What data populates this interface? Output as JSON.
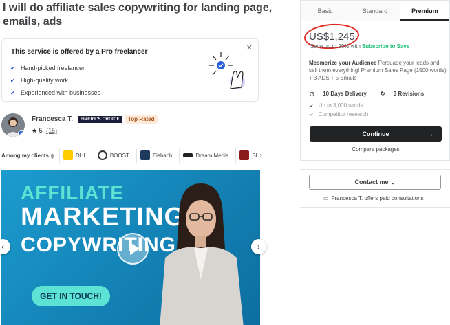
{
  "gig": {
    "title": "I will do affiliate sales copywriting for landing page, emails, ads"
  },
  "pro_box": {
    "heading": "This service is offered by a Pro freelancer",
    "items": [
      "Hand-picked freelancer",
      "High-quality work",
      "Experienced with businesses"
    ],
    "close_icon": "close-icon"
  },
  "seller": {
    "name": "Francesca T.",
    "choice_badge": "FIVERR'S CHOICE",
    "level_badge": "Top Rated",
    "rating": "5",
    "reviews": "(15)"
  },
  "clients": {
    "label": "Among my clients",
    "items": [
      {
        "name": "DHL",
        "color": "#ffcc00"
      },
      {
        "name": "BOOST",
        "color": "#333333"
      },
      {
        "name": "Eisbach",
        "color": "#1f3a5f"
      },
      {
        "name": "Dream Media",
        "color": "#222222"
      },
      {
        "name": "Sl",
        "color": "#8b1a1a"
      }
    ]
  },
  "video": {
    "line1": "AFFILIATE",
    "line2": "MARKETING",
    "line3": "COPYWRITING",
    "cta": "GET IN TOUCH!"
  },
  "package": {
    "tabs": [
      "Basic",
      "Standard",
      "Premium"
    ],
    "active_tab": "Premium",
    "price": "US$1,245",
    "save_text": "Save up to 20% with",
    "subscribe_text": "Subscribe to Save",
    "desc_title": "Mesmerize your Audience",
    "desc_body": "Persuade your leads and sell them everything! Premium Sales Page (1500 words) + 3 ADS + 5 Emails",
    "delivery": "10 Days Delivery",
    "revisions": "3 Revisions",
    "features": [
      "Up to 3,000 words",
      "Competitor research"
    ],
    "continue_label": "Continue",
    "compare_label": "Compare packages"
  },
  "contact": {
    "button_label": "Contact me",
    "consult_text": "Francesca T. offers paid consultations"
  },
  "colors": {
    "accent_green": "#1dbf73",
    "dark": "#222325",
    "annotation_red": "#e0281e"
  }
}
